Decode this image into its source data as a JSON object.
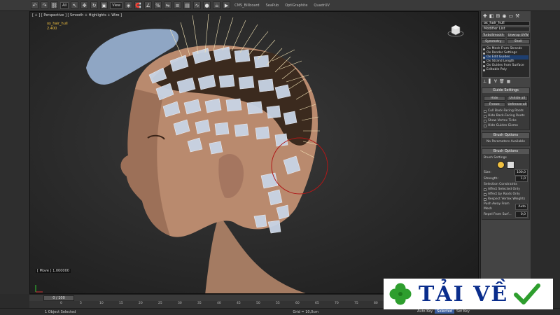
{
  "toolbar": {
    "filter_value": "All",
    "view_value": "View",
    "tabs": [
      "CMS_Billboard",
      "SeaPub",
      "OptiGraphite",
      "QuadrUV"
    ]
  },
  "viewport": {
    "label": "[ + ] [ Perspective ] [ Smooth + Highlights + Wire ]",
    "hair_name": "ox_hair_hull",
    "hair_value": "2.400",
    "move_readout": "[ Move ] 1.000000",
    "axis_labels": [
      "y",
      "x"
    ]
  },
  "panel": {
    "object_name": "ox_hair_hull",
    "modifier_list": "Modifier List",
    "buttons_row1": [
      "TurboSmooth",
      "Unwrap UVW"
    ],
    "buttons_row2": [
      "Symmetry",
      "Shell"
    ],
    "stack": [
      {
        "label": "Ox Mesh From Strands",
        "selected": false
      },
      {
        "label": "Ox Render Settings",
        "selected": false
      },
      {
        "label": "Ox Edit Guides",
        "selected": true
      },
      {
        "label": "Ox Strand Length",
        "selected": false
      },
      {
        "label": "Ox Guides from Surface",
        "selected": false
      },
      {
        "label": "Editable Poly",
        "selected": false
      }
    ],
    "guide_settings": {
      "title": "Guide Settings",
      "hide": "Hide",
      "unhide_all": "Unhide all",
      "freeze": "Freeze",
      "unfreeze_all": "Unfreeze all",
      "checks": [
        "Cull Back-Facing Roots",
        "Hide Back-Facing Roots",
        "Show Vertex Ticks",
        "Hide Guides Gizmo"
      ]
    },
    "brush_options": {
      "title": "Brush Options",
      "text": "No Parameters Available"
    },
    "brush_options2": {
      "title": "Brush Options",
      "settings_label": "Brush Settings",
      "size_label": "Size:",
      "size_value": "100,0",
      "strength_label": "Strength:",
      "strength_value": "1,0",
      "constraints_label": "Selection Constraints",
      "checks": [
        "Affect Selected Only",
        "Affect by Roots Only",
        "Respect Vertex Weights"
      ],
      "push_label": "Push Away From Mesh",
      "push_btn": "Auto",
      "repel_label": "Repel From Surf...",
      "repel_value": "0,0"
    }
  },
  "timeline": {
    "frame": "0 / 100",
    "ticks": [
      "0",
      "5",
      "10",
      "15",
      "20",
      "25",
      "30",
      "35",
      "40",
      "45",
      "50",
      "55",
      "60",
      "65",
      "70",
      "75",
      "80",
      "85",
      "90",
      "95",
      "100"
    ]
  },
  "statusbar": {
    "selection": "1 Object Selected",
    "grid": "Grid = 10,0cm",
    "autokey": "Auto Key",
    "selected_dd": "Selected",
    "setkey": "Set Key"
  },
  "watermark": {
    "text": "TẢI VỀ"
  },
  "colors": {
    "accent": "#f0c040",
    "wm_blue": "#0a2d8c",
    "wm_green": "#2e9e2e"
  }
}
